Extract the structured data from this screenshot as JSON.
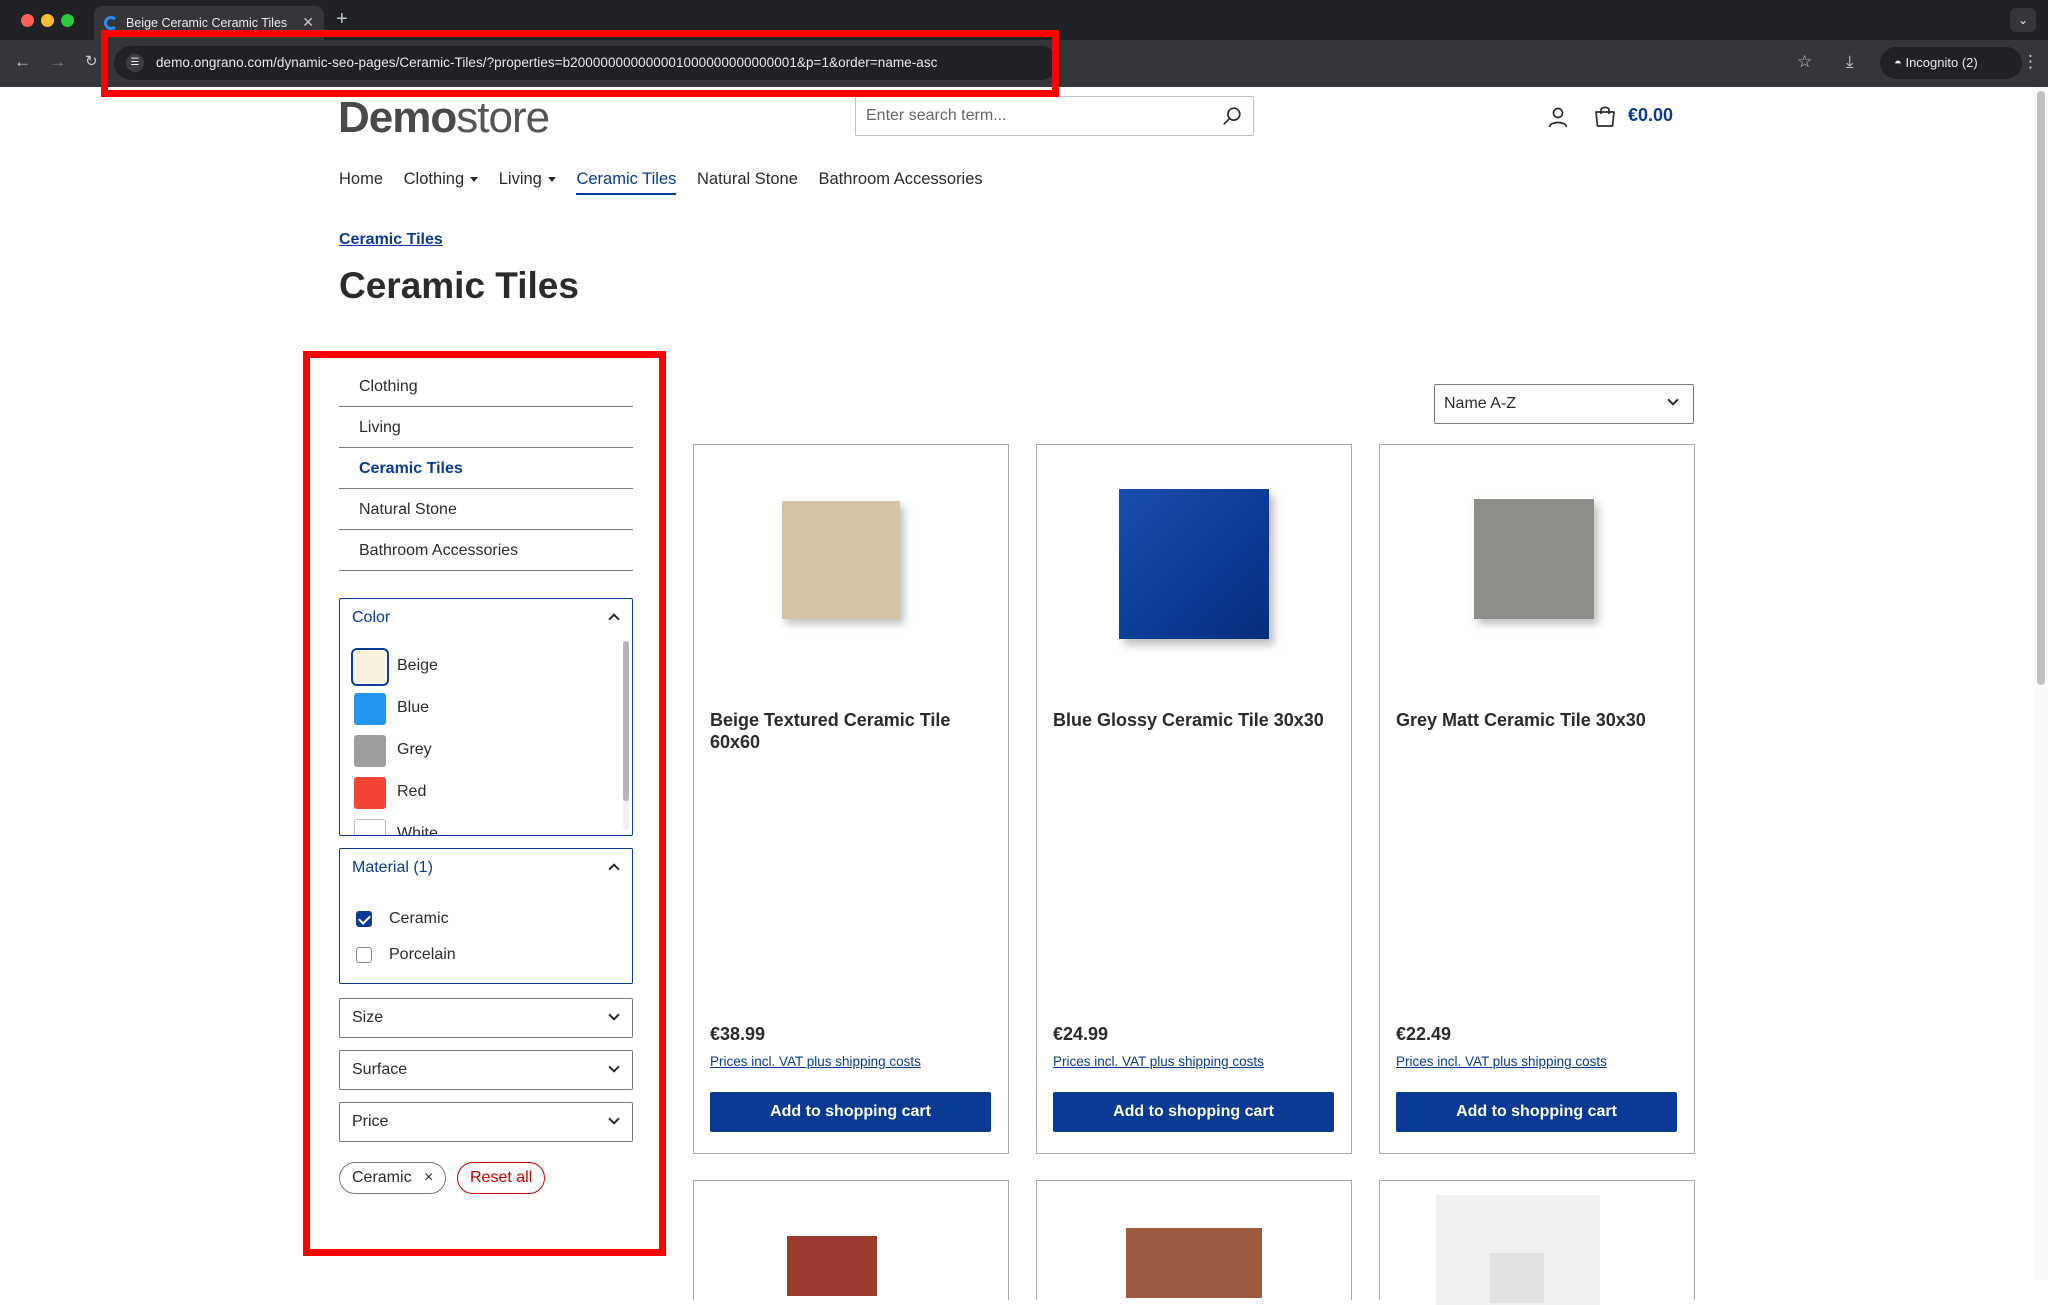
{
  "browser": {
    "tab_title": "Beige Ceramic Ceramic Tiles",
    "tab_close": "✕",
    "new_tab": "+",
    "url": "demo.ongrano.com/dynamic-seo-pages/Ceramic-Tiles/?properties=b200000000000001000000000000001&p=1&order=name-asc",
    "profile": "Incognito (2)"
  },
  "header": {
    "logo_bold": "Demo",
    "logo_light": "store",
    "search_placeholder": "Enter search term...",
    "cart_total": "€0.00"
  },
  "main_nav": {
    "items": [
      {
        "label": "Home"
      },
      {
        "label": "Clothing"
      },
      {
        "label": "Living"
      },
      {
        "label": "Ceramic Tiles"
      },
      {
        "label": "Natural Stone"
      },
      {
        "label": "Bathroom Accessories"
      }
    ]
  },
  "breadcrumb": "Ceramic Tiles",
  "page_title": "Ceramic Tiles",
  "sidebar": {
    "categories": [
      {
        "label": "Clothing"
      },
      {
        "label": "Living"
      },
      {
        "label": "Ceramic Tiles"
      },
      {
        "label": "Natural Stone"
      },
      {
        "label": "Bathroom Accessories"
      }
    ],
    "color_filter": {
      "title": "Color",
      "options": [
        {
          "label": "Beige",
          "color": "#f5f1dc",
          "selected": true
        },
        {
          "label": "Blue",
          "color": "#2196f3",
          "selected": false
        },
        {
          "label": "Grey",
          "color": "#9e9e9e",
          "selected": false
        },
        {
          "label": "Red",
          "color": "#f44336",
          "selected": false
        },
        {
          "label": "White",
          "color": "#ffffff",
          "selected": false
        }
      ]
    },
    "material_filter": {
      "title": "Material (1)",
      "options": [
        {
          "label": "Ceramic",
          "checked": true
        },
        {
          "label": "Porcelain",
          "checked": false
        }
      ]
    },
    "size_filter": "Size",
    "surface_filter": "Surface",
    "price_filter": "Price",
    "active_filter_chip": "Ceramic",
    "chip_remove": "×",
    "reset_all": "Reset all"
  },
  "sort": {
    "selected": "Name A-Z"
  },
  "products": [
    {
      "name": "Beige Textured Ceramic Tile 60x60",
      "price": "€38.99",
      "vat_note": "Prices incl. VAT plus shipping costs",
      "button": "Add to shopping cart",
      "tile_color": "#d4c3a5"
    },
    {
      "name": "Blue Glossy Ceramic Tile 30x30",
      "price": "€24.99",
      "vat_note": "Prices incl. VAT plus shipping costs",
      "button": "Add to shopping cart",
      "tile_color": "#0c3d9a"
    },
    {
      "name": "Grey Matt Ceramic Tile 30x30",
      "price": "€22.49",
      "vat_note": "Prices incl. VAT plus shipping costs",
      "button": "Add to shopping cart",
      "tile_color": "#8f8e8b"
    }
  ],
  "colors": {
    "brand_blue": "#0b3a94",
    "highlight_red": "#ff0000",
    "reset_red": "#c40000"
  }
}
